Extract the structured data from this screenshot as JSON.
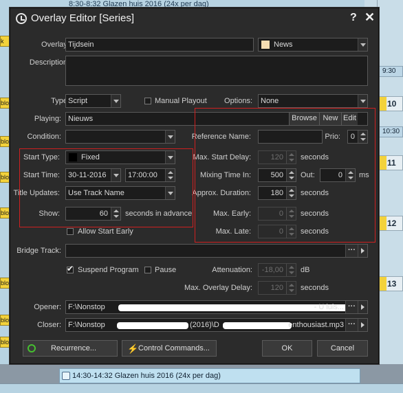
{
  "background": {
    "top_strip": "8:30-8:32 Glazen huis 2016 (24x per dag)",
    "bottom_item": "14:30-14:32 Glazen huis 2016 (24x per dag)",
    "right_times": [
      "9:30",
      "10:30"
    ],
    "left_tags": [
      "k V",
      "blo",
      "blo",
      "blo",
      "blo",
      "blo",
      "blo",
      "blo"
    ],
    "right_rows": [
      "10",
      "11",
      "12",
      "13"
    ]
  },
  "window": {
    "title": "Overlay Editor [Series]",
    "help": "?",
    "close": "✕"
  },
  "form": {
    "overlay": {
      "label": "Overlay:",
      "value": "Tijdsein",
      "category": "News",
      "category_color": "#f5deb3"
    },
    "description": {
      "label": "Description:",
      "value": ""
    },
    "type": {
      "label": "Type:",
      "value": "Script"
    },
    "manual_playout": {
      "label": "Manual Playout",
      "checked": false
    },
    "options": {
      "label": "Options:",
      "value": "None"
    },
    "playing": {
      "label": "Playing:",
      "value": "Nieuws",
      "browse": "Browse",
      "new": "New",
      "edit": "Edit"
    },
    "condition": {
      "label": "Condition:",
      "value": ""
    },
    "reference_name": {
      "label": "Reference Name:",
      "value": ""
    },
    "prio": {
      "label": "Prio:",
      "value": "0"
    },
    "start_type": {
      "label": "Start Type:",
      "value": "Fixed",
      "swatch": "#000000"
    },
    "max_start_delay": {
      "label": "Max. Start Delay:",
      "value": "120",
      "unit": "seconds"
    },
    "start_time": {
      "label": "Start Time:",
      "date": "30-11-2016",
      "time": "17:00:00"
    },
    "mixing_time_in": {
      "label": "Mixing Time In:",
      "value": "500",
      "out_label": "Out:",
      "out_value": "0",
      "unit": "ms"
    },
    "title_updates": {
      "label": "Title Updates:",
      "value": "Use Track Name"
    },
    "approx_duration": {
      "label": "Approx. Duration:",
      "value": "180",
      "unit": "seconds"
    },
    "show": {
      "label": "Show:",
      "value": "60",
      "unit": "seconds in advance"
    },
    "max_early": {
      "label": "Max. Early:",
      "value": "0",
      "unit": "seconds"
    },
    "allow_start_early": {
      "label": "Allow Start Early",
      "checked": false
    },
    "max_late": {
      "label": "Max. Late:",
      "value": "0",
      "unit": "seconds"
    },
    "bridge_track": {
      "label": "Bridge Track:",
      "value": ""
    },
    "suspend_program": {
      "label": "Suspend Program",
      "checked": true
    },
    "pause": {
      "label": "Pause",
      "checked": false
    },
    "attenuation": {
      "label": "Attenuation:",
      "value": "-18,00",
      "unit": "dB"
    },
    "max_overlay_delay": {
      "label": "Max. Overlay Delay:",
      "value": "120",
      "unit": "seconds"
    },
    "opener": {
      "label": "Opener:",
      "value_start": "F:\\Nonstop",
      "value_end": "- U luis..."
    },
    "closer": {
      "label": "Closer:",
      "value_start": "F:\\Nonstop",
      "value_mid": "(2016)\\D",
      "value_end": "enthousiast.mp3"
    }
  },
  "buttons": {
    "recurrence": "Recurrence...",
    "control_commands": "Control Commands...",
    "ok": "OK",
    "cancel": "Cancel"
  }
}
